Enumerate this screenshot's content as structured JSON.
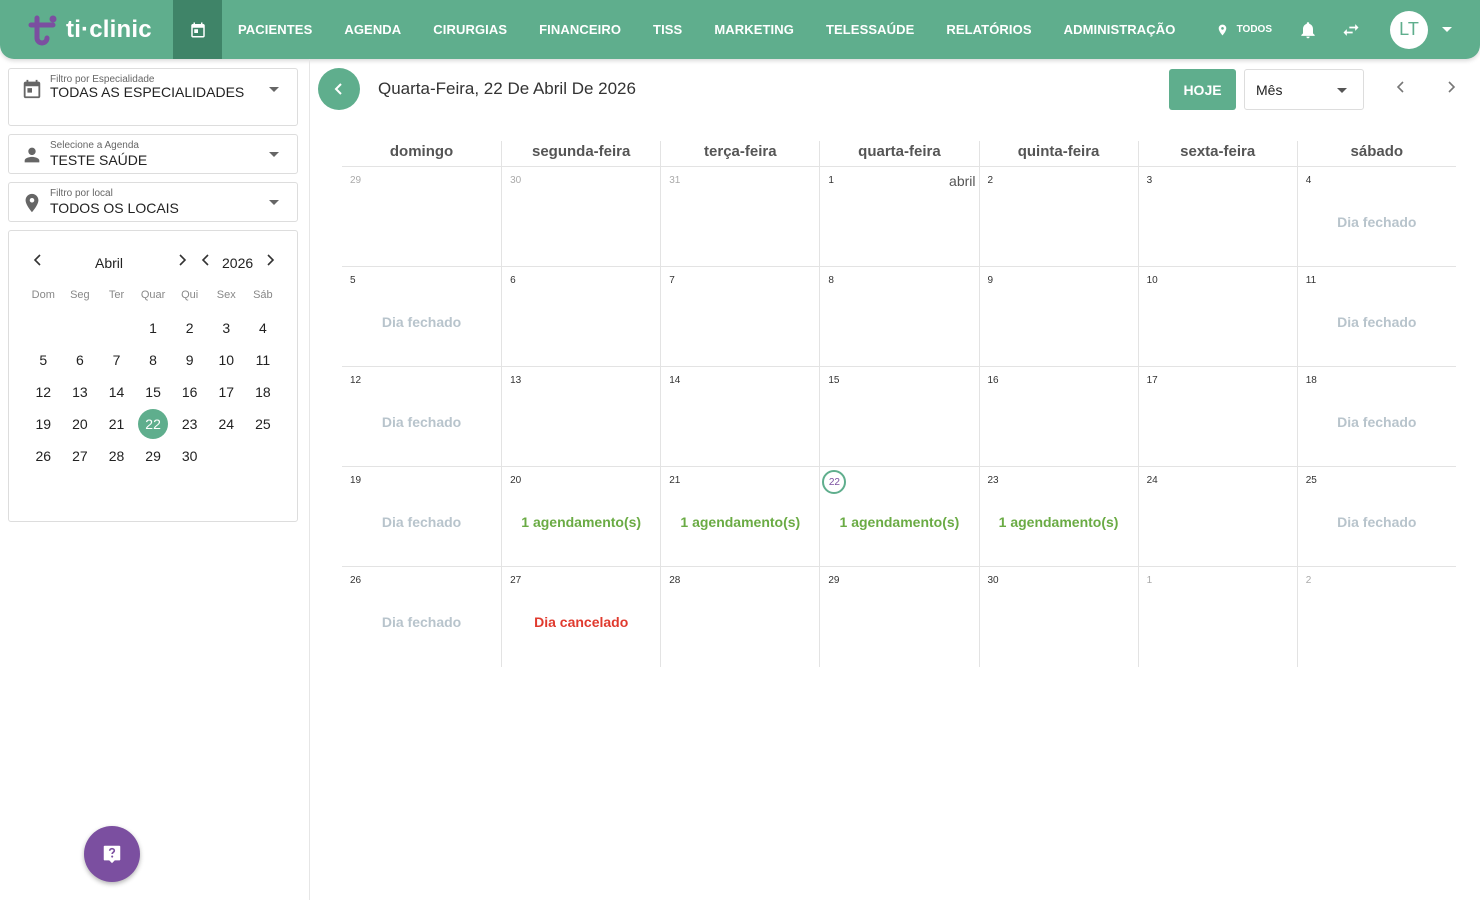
{
  "app": {
    "brand": "ti·clinic",
    "nav": [
      "PACIENTES",
      "AGENDA",
      "CIRURGIAS",
      "FINANCEIRO",
      "TISS",
      "MARKETING",
      "TELESSAÚDE",
      "RELATÓRIOS",
      "ADMINISTRAÇÃO"
    ],
    "location": "TODOS",
    "avatar": "LT",
    "colors": {
      "primary": "#5fae8d",
      "primary_dark": "#3f8468",
      "help": "#7b4fa0",
      "closed": "#b8c4cc",
      "appointment": "#6aab44",
      "cancelled": "#e03a2e"
    }
  },
  "filters": {
    "specialty": {
      "label": "Filtro por Especialidade",
      "value": "TODAS AS ESPECIALIDADES",
      "icon": "calendar-icon"
    },
    "agenda": {
      "label": "Selecione a Agenda",
      "value": "TESTE SAÚDE",
      "icon": "person-icon"
    },
    "local": {
      "label": "Filtro por local",
      "value": "TODOS OS LOCAIS",
      "icon": "location-pin-icon"
    }
  },
  "mini_calendar": {
    "month": "Abril",
    "year": "2026",
    "dow": [
      "Dom",
      "Seg",
      "Ter",
      "Quar",
      "Qui",
      "Sex",
      "Sáb"
    ],
    "leading_blanks": 3,
    "days": 30,
    "selected": 22
  },
  "main": {
    "date_title": "Quarta-Feira, 22 De Abril De 2026",
    "today_label": "HOJE",
    "view": "Mês",
    "weekdays": [
      "domingo",
      "segunda-feira",
      "terça-feira",
      "quarta-feira",
      "quinta-feira",
      "sexta-feira",
      "sábado"
    ],
    "month_label": "abril",
    "weeks": [
      [
        {
          "d": "29",
          "other": true
        },
        {
          "d": "30",
          "other": true
        },
        {
          "d": "31",
          "other": true
        },
        {
          "d": "1",
          "month": true
        },
        {
          "d": "2"
        },
        {
          "d": "3"
        },
        {
          "d": "4",
          "status": "Dia fechado",
          "kind": "closed"
        }
      ],
      [
        {
          "d": "5",
          "status": "Dia fechado",
          "kind": "closed"
        },
        {
          "d": "6"
        },
        {
          "d": "7"
        },
        {
          "d": "8"
        },
        {
          "d": "9"
        },
        {
          "d": "10"
        },
        {
          "d": "11",
          "status": "Dia fechado",
          "kind": "closed"
        }
      ],
      [
        {
          "d": "12",
          "status": "Dia fechado",
          "kind": "closed"
        },
        {
          "d": "13"
        },
        {
          "d": "14"
        },
        {
          "d": "15"
        },
        {
          "d": "16"
        },
        {
          "d": "17"
        },
        {
          "d": "18",
          "status": "Dia fechado",
          "kind": "closed"
        }
      ],
      [
        {
          "d": "19",
          "status": "Dia fechado",
          "kind": "closed"
        },
        {
          "d": "20",
          "status": "1 agendamento(s)",
          "kind": "appt"
        },
        {
          "d": "21",
          "status": "1 agendamento(s)",
          "kind": "appt"
        },
        {
          "d": "22",
          "today": true,
          "status": "1 agendamento(s)",
          "kind": "appt"
        },
        {
          "d": "23",
          "status": "1 agendamento(s)",
          "kind": "appt"
        },
        {
          "d": "24"
        },
        {
          "d": "25",
          "status": "Dia fechado",
          "kind": "closed"
        }
      ],
      [
        {
          "d": "26",
          "status": "Dia fechado",
          "kind": "closed"
        },
        {
          "d": "27",
          "status": "Dia cancelado",
          "kind": "cancelled"
        },
        {
          "d": "28"
        },
        {
          "d": "29"
        },
        {
          "d": "30"
        },
        {
          "d": "1",
          "other": true
        },
        {
          "d": "2",
          "other": true
        }
      ]
    ]
  }
}
